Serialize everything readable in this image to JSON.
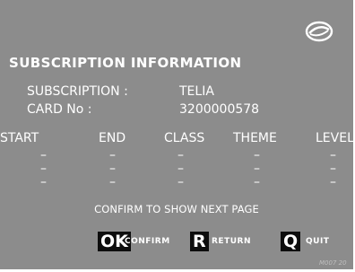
{
  "header": {
    "title": "SUBSCRIPTION INFORMATION",
    "logo_icon": "ellipse-logo-icon"
  },
  "info": {
    "subscription_label": "SUBSCRIPTION :",
    "subscription_value": "TELIA",
    "card_label": "CARD No :",
    "card_value": "3200000578"
  },
  "table": {
    "columns": [
      "START",
      "END",
      "CLASS",
      "THEME",
      "LEVEL"
    ],
    "rows": [
      [
        "–",
        "–",
        "–",
        "–",
        "–"
      ],
      [
        "–",
        "–",
        "–",
        "–",
        "–"
      ],
      [
        "–",
        "–",
        "–",
        "–",
        "–"
      ]
    ]
  },
  "prompt": "CONFIRM TO SHOW NEXT PAGE",
  "keys": [
    {
      "key": "OK",
      "label": "CONFIRM"
    },
    {
      "key": "R",
      "label": "RETURN"
    },
    {
      "key": "Q",
      "label": "QUIT"
    }
  ],
  "screen_ref": "M007 20",
  "colors": {
    "background": "#8c8c8c",
    "text": "#ffffff",
    "key_bg": "#0d0d0d"
  }
}
